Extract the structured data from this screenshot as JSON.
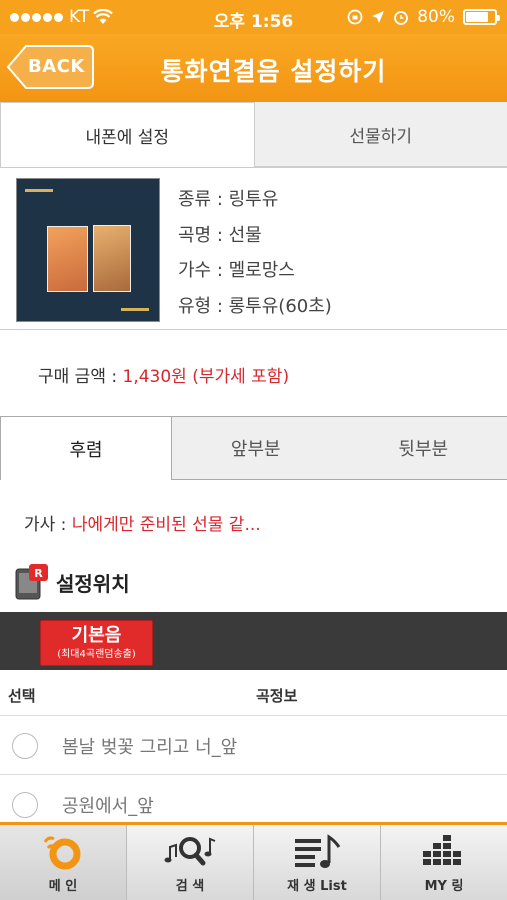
{
  "status": {
    "carrier": "KT",
    "time": "오후 1:56",
    "battery": "80%"
  },
  "header": {
    "back_label": "BACK",
    "title": "통화연결음 설정하기"
  },
  "top_tabs": [
    {
      "label": "내폰에 설정"
    },
    {
      "label": "선물하기"
    }
  ],
  "song": {
    "lines": [
      "종류 : 링투유",
      "곡명 : 선물",
      "가수 : 멜로망스",
      "유형 : 롱투유(60초)"
    ]
  },
  "price": {
    "label": "구매 금액 : ",
    "value": "1,430원 (부가세 포함)"
  },
  "segment_tabs": [
    {
      "label": "후렴"
    },
    {
      "label": "앞부분"
    },
    {
      "label": "뒷부분"
    }
  ],
  "lyrics": {
    "label": "가사 : ",
    "value": "나에게만 준비된 선물 같..."
  },
  "location": {
    "label": "설정위치"
  },
  "default_button": {
    "line1": "기본음",
    "line2": "(최대4곡랜덤송출)"
  },
  "list_header": {
    "select": "선택",
    "info": "곡정보"
  },
  "songs": [
    {
      "title": "봄날 벚꽃 그리고 너_앞"
    },
    {
      "title": "공원에서_앞"
    }
  ],
  "bottom_nav": [
    {
      "label": "메 인"
    },
    {
      "label": "검 색"
    },
    {
      "label": "재 생 List"
    },
    {
      "label": "MY 링"
    }
  ],
  "colors": {
    "accent": "#f39514",
    "red": "#d7282f",
    "dark_bar": "#3a3a3a"
  }
}
